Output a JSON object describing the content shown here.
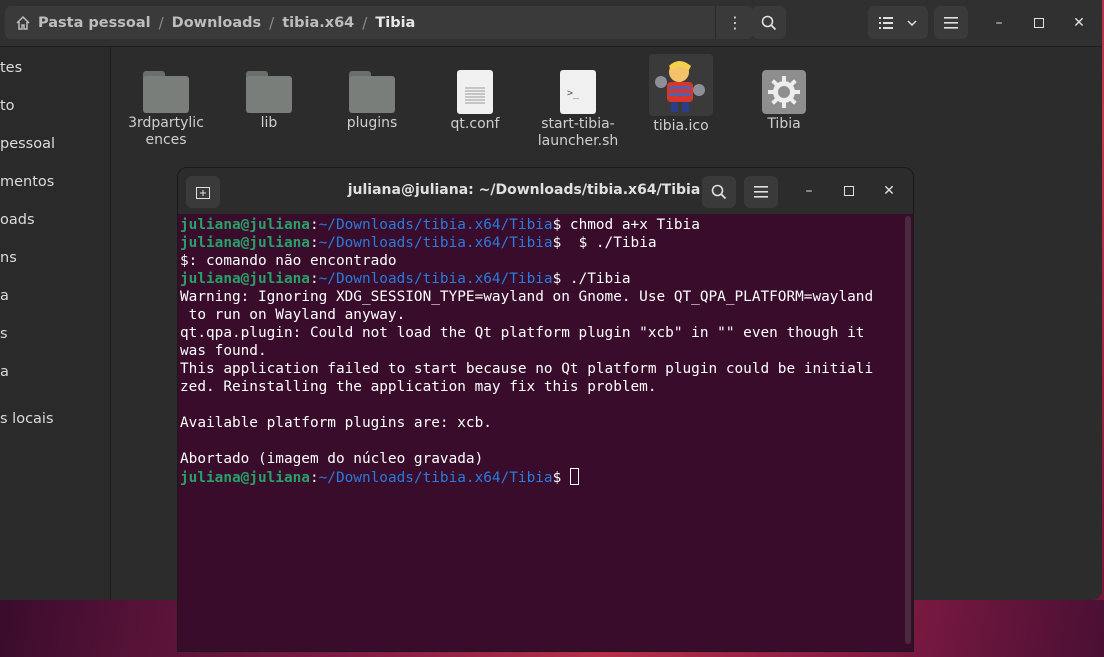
{
  "files_window": {
    "breadcrumb": [
      "Pasta pessoal",
      "Downloads",
      "tibia.x64",
      "Tibia"
    ],
    "sidebar_items": [
      "tes",
      "to",
      "pessoal",
      "mentos",
      "oads",
      "ns",
      "a",
      "s",
      "a",
      "s locais"
    ],
    "files": [
      {
        "label": "3rdpartylic\nences",
        "type": "folder"
      },
      {
        "label": "lib",
        "type": "folder"
      },
      {
        "label": "plugins",
        "type": "folder"
      },
      {
        "label": "qt.conf",
        "type": "text"
      },
      {
        "label": "start-tibia-\nlauncher.sh",
        "type": "script"
      },
      {
        "label": "tibia.ico",
        "type": "image"
      },
      {
        "label": "Tibia",
        "type": "executable"
      }
    ]
  },
  "terminal": {
    "title": "juliana@juliana: ~/Downloads/tibia.x64/Tibia",
    "user_host": "juliana@juliana",
    "path": "~/Downloads/tibia.x64/Tibia",
    "lines": [
      {
        "kind": "prompt",
        "cmd": " chmod a+x Tibia"
      },
      {
        "kind": "prompt",
        "cmd": "  $ ./Tibia"
      },
      {
        "kind": "out",
        "text": "$: comando não encontrado"
      },
      {
        "kind": "prompt",
        "cmd": " ./Tibia"
      },
      {
        "kind": "out",
        "text": "Warning: Ignoring XDG_SESSION_TYPE=wayland on Gnome. Use QT_QPA_PLATFORM=wayland"
      },
      {
        "kind": "out",
        "text": " to run on Wayland anyway."
      },
      {
        "kind": "out",
        "text": "qt.qpa.plugin: Could not load the Qt platform plugin \"xcb\" in \"\" even though it"
      },
      {
        "kind": "out",
        "text": "was found."
      },
      {
        "kind": "out",
        "text": "This application failed to start because no Qt platform plugin could be initiali"
      },
      {
        "kind": "out",
        "text": "zed. Reinstalling the application may fix this problem."
      },
      {
        "kind": "out",
        "text": ""
      },
      {
        "kind": "out",
        "text": "Available platform plugins are: xcb."
      },
      {
        "kind": "out",
        "text": ""
      },
      {
        "kind": "out",
        "text": "Abortado (imagem do núcleo gravada)"
      },
      {
        "kind": "prompt_cursor",
        "cmd": " "
      }
    ]
  },
  "colors": {
    "terminal_bg": "#380c2a",
    "prompt_user": "#26a269",
    "prompt_path": "#2a7bde",
    "window_bg": "#2c2c2c"
  }
}
